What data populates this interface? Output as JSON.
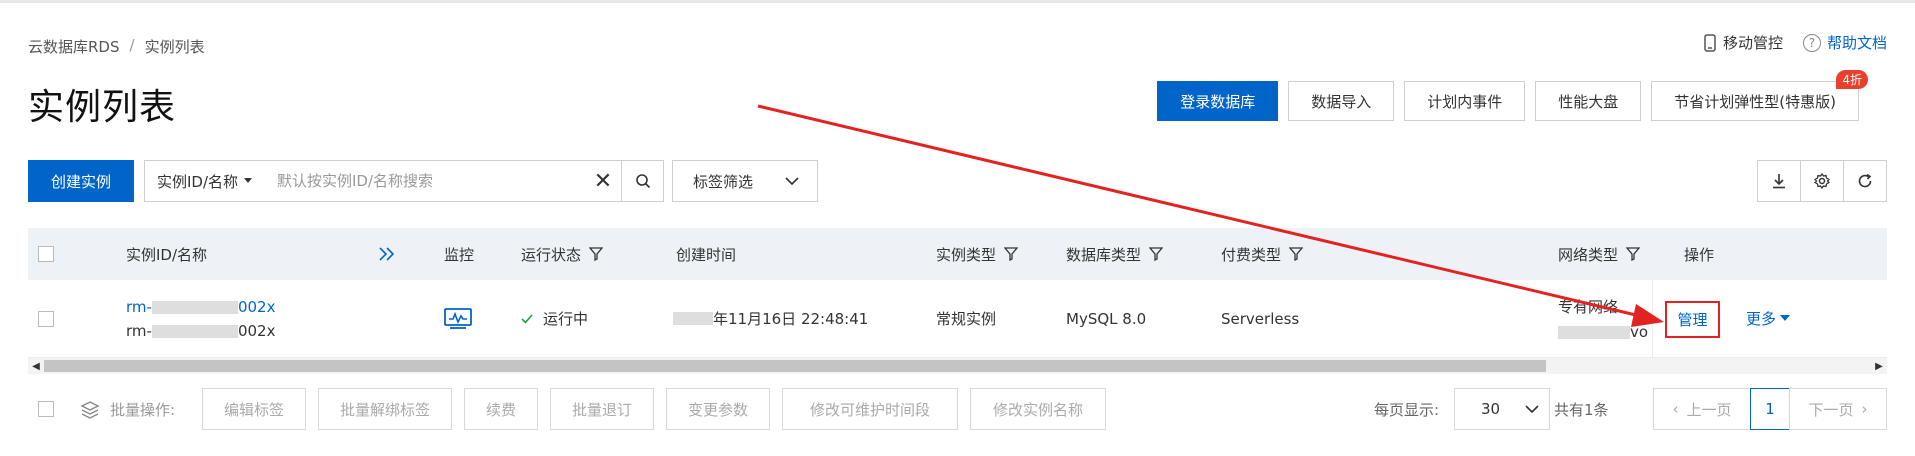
{
  "breadcrumb": {
    "root": "云数据库RDS",
    "sep": "/",
    "current": "实例列表"
  },
  "topLinks": {
    "mobile": "移动管控",
    "help": "帮助文档"
  },
  "page": {
    "title": "实例列表"
  },
  "headerButtons": {
    "login": "登录数据库",
    "import": "数据导入",
    "events": "计划内事件",
    "perf": "性能大盘",
    "savings": "节省计划弹性型(特惠版)",
    "savingsBadge": "4折"
  },
  "toolbar": {
    "create": "创建实例",
    "searchType": "实例ID/名称",
    "searchPlaceholder": "默认按实例ID/名称搜索",
    "tagFilter": "标签筛选"
  },
  "table": {
    "columns": {
      "id": "实例ID/名称",
      "monitor": "监控",
      "status": "运行状态",
      "created": "创建时间",
      "instType": "实例类型",
      "dbType": "数据库类型",
      "payType": "付费类型",
      "network": "网络类型",
      "ops": "操作"
    },
    "row": {
      "idPrefix": "rm-",
      "idSuffix": "002x",
      "namePrefix": "rm-",
      "nameSuffix": "002x",
      "status": "运行中",
      "createdSuffix": "年11月16日 22:48:41",
      "instType": "常规实例",
      "dbType": "MySQL 8.0",
      "payType": "Serverless",
      "network": "专有网络",
      "networkSub": "vo",
      "manage": "管理",
      "more": "更多"
    }
  },
  "footer": {
    "batchLabel": "批量操作:",
    "buttons": [
      "编辑标签",
      "批量解绑标签",
      "续费",
      "批量退订",
      "变更参数",
      "修改可维护时间段",
      "修改实例名称"
    ],
    "perPageLabel": "每页显示:",
    "perPage": "30",
    "total": "共有1条",
    "prev": "上一页",
    "page": "1",
    "next": "下一页"
  },
  "colors": {
    "primary": "#0064c8",
    "annotation": "#e32222"
  }
}
